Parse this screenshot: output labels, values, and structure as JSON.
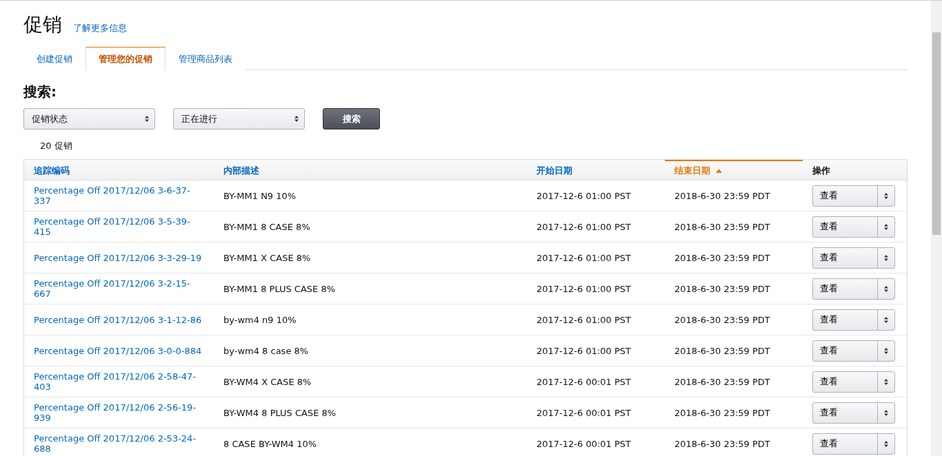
{
  "page": {
    "title": "促销",
    "learn_more": "了解更多信息"
  },
  "tabs": [
    {
      "label": "创建促销",
      "selected": false
    },
    {
      "label": "管理您的促销",
      "selected": true
    },
    {
      "label": "管理商品列表",
      "selected": false
    }
  ],
  "search": {
    "heading": "搜索:",
    "filter_field": "促销状态",
    "filter_value": "正在进行",
    "button": "搜索"
  },
  "result_count": "20 促销",
  "table": {
    "columns": [
      {
        "label": "追踪编码",
        "sorted": false
      },
      {
        "label": "内部描述",
        "sorted": false
      },
      {
        "label": "开始日期",
        "sorted": false
      },
      {
        "label": "结束日期",
        "sorted": true
      },
      {
        "label": "操作",
        "sorted": false,
        "kind": "plain"
      }
    ],
    "rows": [
      {
        "tracking_code": "Percentage Off 2017/12/06 3-6-37-337",
        "description": "BY-MM1 N9 10%",
        "start": "2017-12-6 01:00 PST",
        "end": "2018-6-30 23:59 PDT",
        "action": "查看"
      },
      {
        "tracking_code": "Percentage Off 2017/12/06 3-5-39-415",
        "description": "BY-MM1 8 CASE 8%",
        "start": "2017-12-6 01:00 PST",
        "end": "2018-6-30 23:59 PDT",
        "action": "查看"
      },
      {
        "tracking_code": "Percentage Off 2017/12/06 3-3-29-19",
        "description": "BY-MM1 X CASE 8%",
        "start": "2017-12-6 01:00 PST",
        "end": "2018-6-30 23:59 PDT",
        "action": "查看"
      },
      {
        "tracking_code": "Percentage Off 2017/12/06 3-2-15-667",
        "description": "BY-MM1 8 PLUS CASE 8%",
        "start": "2017-12-6 01:00 PST",
        "end": "2018-6-30 23:59 PDT",
        "action": "查看"
      },
      {
        "tracking_code": "Percentage Off 2017/12/06 3-1-12-86",
        "description": "by-wm4 n9 10%",
        "start": "2017-12-6 01:00 PST",
        "end": "2018-6-30 23:59 PDT",
        "action": "查看"
      },
      {
        "tracking_code": "Percentage Off 2017/12/06 3-0-0-884",
        "description": "by-wm4 8 case 8%",
        "start": "2017-12-6 01:00 PST",
        "end": "2018-6-30 23:59 PDT",
        "action": "查看"
      },
      {
        "tracking_code": "Percentage Off 2017/12/06 2-58-47-403",
        "description": "BY-WM4 X CASE 8%",
        "start": "2017-12-6 00:01 PST",
        "end": "2018-6-30 23:59 PDT",
        "action": "查看"
      },
      {
        "tracking_code": "Percentage Off 2017/12/06 2-56-19-939",
        "description": "BY-WM4 8 PLUS CASE 8%",
        "start": "2017-12-6 00:01 PST",
        "end": "2018-6-30 23:59 PDT",
        "action": "查看"
      },
      {
        "tracking_code": "Percentage Off 2017/12/06 2-53-24-688",
        "description": "8 CASE BY-WM4 10%",
        "start": "2017-12-6 00:01 PST",
        "end": "2018-6-30 23:59 PDT",
        "action": "查看"
      }
    ]
  }
}
